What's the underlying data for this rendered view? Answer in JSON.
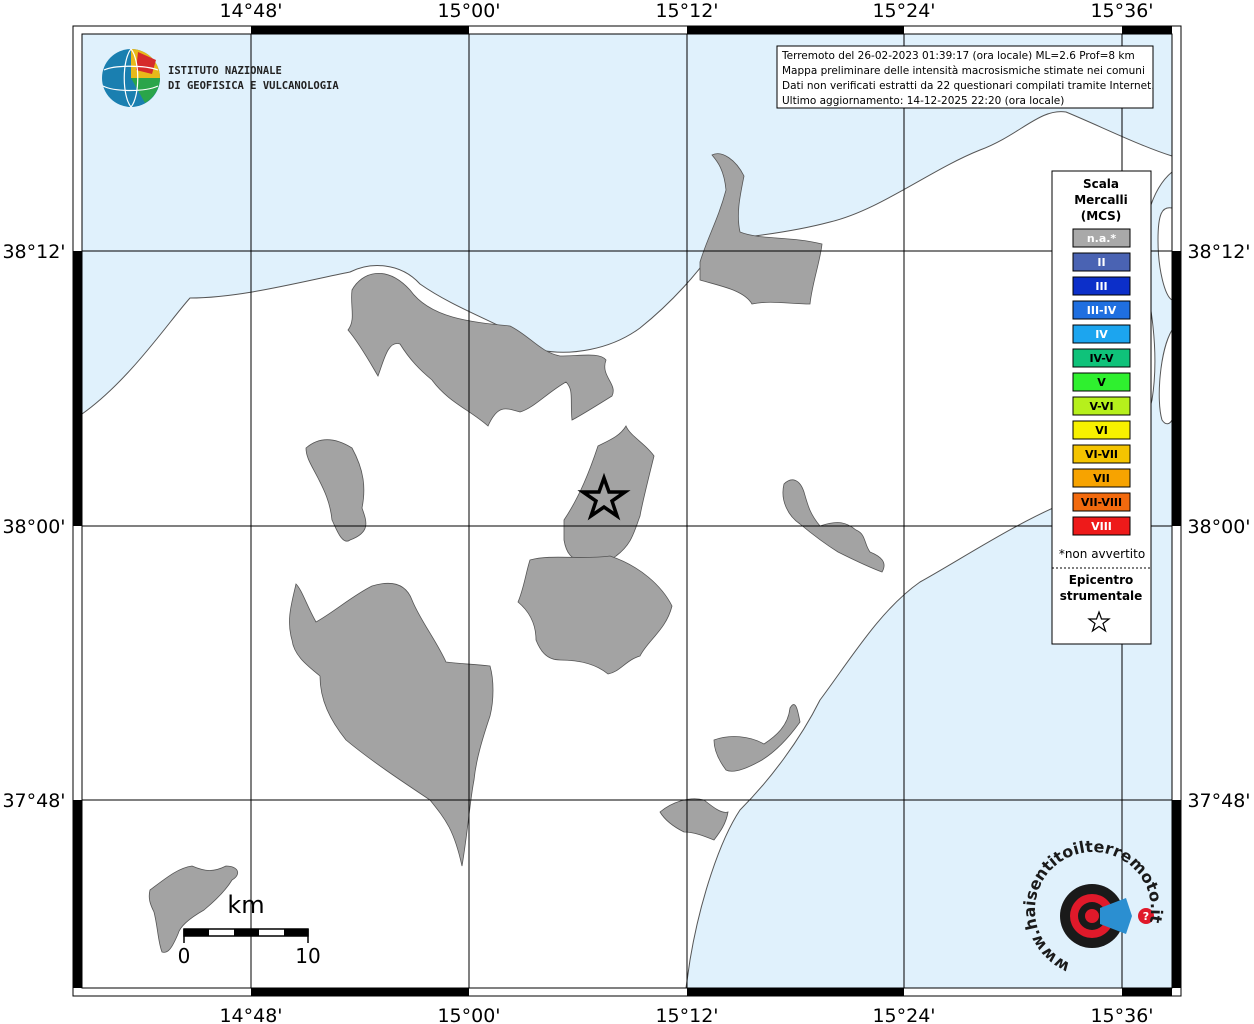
{
  "map": {
    "lon_labels": [
      "14°48'",
      "15°00'",
      "15°12'",
      "15°24'",
      "15°36'"
    ],
    "lat_labels": [
      "38°12'",
      "38°00'",
      "37°48'"
    ]
  },
  "info_box": {
    "lines": [
      "Terremoto del 26-02-2023 01:39:17 (ora locale) ML=2.6 Prof=8 km",
      "Mappa preliminare delle intensità macrosismiche stimate nei comuni",
      "Dati non verificati estratti da 22 questionari compilati tramite Internet.",
      "Ultimo aggiornamento: 14-12-2025 22:20 (ora locale)"
    ]
  },
  "logo_ingv": {
    "line1": "ISTITUTO NAZIONALE",
    "line2": "DI GEOFISICA E VULCANOLOGIA"
  },
  "logo_hsit": {
    "text": "www.haisentitoilterremoto.it"
  },
  "legend": {
    "title_lines": [
      "Scala",
      "Mercalli",
      "(MCS)"
    ],
    "items": [
      {
        "label": "n.a.*",
        "color": "#a9a9a9"
      },
      {
        "label": "II",
        "color": "#4a63b3"
      },
      {
        "label": "III",
        "color": "#0c2fc9"
      },
      {
        "label": "III-IV",
        "color": "#1f6fe0"
      },
      {
        "label": "IV",
        "color": "#1ca5ef"
      },
      {
        "label": "IV-V",
        "color": "#0fc27a"
      },
      {
        "label": "V",
        "color": "#2ff02f"
      },
      {
        "label": "V-VI",
        "color": "#b6f01c"
      },
      {
        "label": "VI",
        "color": "#f7f100"
      },
      {
        "label": "VI-VII",
        "color": "#f4c400"
      },
      {
        "label": "VII",
        "color": "#f7a300"
      },
      {
        "label": "VII-VIII",
        "color": "#f26a0e"
      },
      {
        "label": "VIII",
        "color": "#ee1a1a"
      }
    ],
    "note": "*non avvertito",
    "epicenter_lines": [
      "Epicentro",
      "strumentale"
    ]
  },
  "scale_bar": {
    "unit": "km",
    "min_label": "0",
    "max_label": "10"
  },
  "colors": {
    "sea": "#e0f1fc",
    "land": "#ffffff",
    "felt_area": "#a3a3a3",
    "grid": "#000000"
  }
}
